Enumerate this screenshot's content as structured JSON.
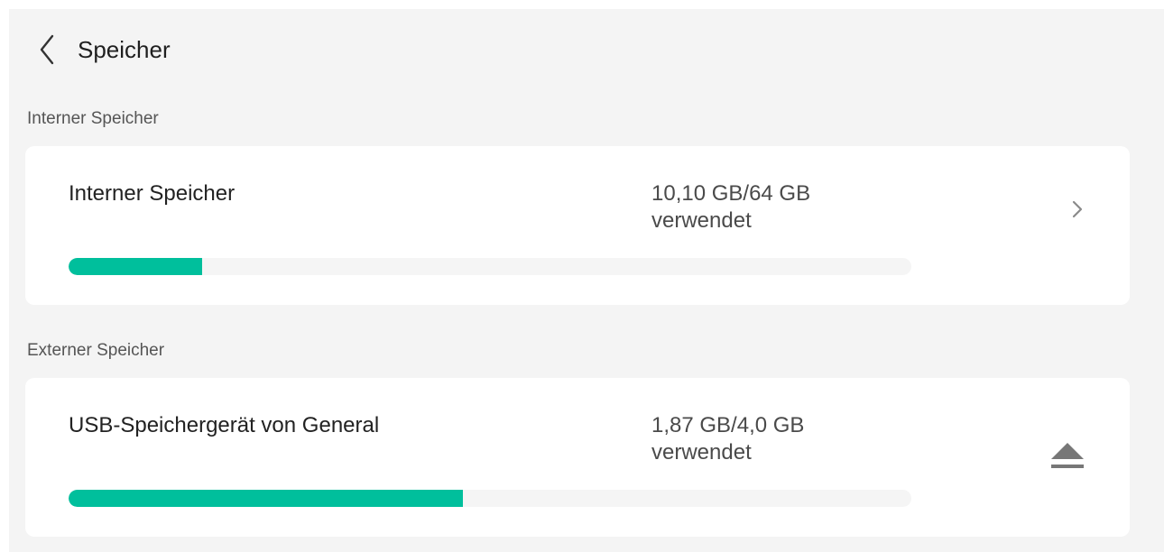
{
  "header": {
    "title": "Speicher",
    "back_icon": "chevron-left-icon"
  },
  "internal": {
    "section_label": "Interner Speicher",
    "name": "Interner Speicher",
    "usage_amount": "10,10 GB/64 GB",
    "usage_suffix": "verwendet",
    "used_fraction": 0.158,
    "action_icon": "chevron-right-icon"
  },
  "external": {
    "section_label": "Externer Speicher",
    "name": "USB-Speichergerät von General",
    "usage_amount": "1,87 GB/4,0 GB",
    "usage_suffix": "verwendet",
    "used_fraction": 0.4675,
    "action_icon": "eject-icon"
  },
  "colors": {
    "accent": "#00bf9c",
    "background": "#f4f4f4",
    "card": "#ffffff"
  }
}
